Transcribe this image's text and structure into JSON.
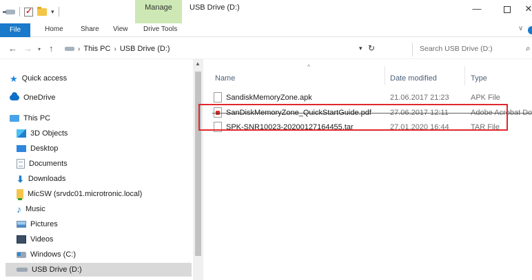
{
  "window": {
    "title": "USB Drive (D:)",
    "context_tab": "Manage",
    "controls": {
      "minimize": "—",
      "maximize": "",
      "close": "✕"
    }
  },
  "quick_access_toolbar": {
    "dropdown": "▾"
  },
  "ribbon": {
    "tabs": [
      "File",
      "Home",
      "Share",
      "View",
      "Drive Tools"
    ],
    "expand": "∨",
    "accent_color": "#1979ca",
    "manage_color": "#cde8b4"
  },
  "address_bar": {
    "back": "←",
    "forward": "→",
    "recent": "▾",
    "up": "↑",
    "separator": "›",
    "breadcrumbs": [
      "This PC",
      "USB Drive (D:)"
    ],
    "dropdown": "▾",
    "refresh": "↻"
  },
  "search": {
    "placeholder": "Search USB Drive (D:)",
    "icon": "search-icon"
  },
  "nav_pane": {
    "items": [
      {
        "label": "Quick access",
        "icon": "star-icon"
      },
      {
        "label": "OneDrive",
        "icon": "cloud-icon"
      },
      {
        "label": "This PC",
        "icon": "computer-icon"
      },
      {
        "label": "3D Objects",
        "icon": "cube-icon"
      },
      {
        "label": "Desktop",
        "icon": "desktop-icon"
      },
      {
        "label": "Documents",
        "icon": "document-icon"
      },
      {
        "label": "Downloads",
        "icon": "download-icon"
      },
      {
        "label": "MicSW (srvdc01.microtronic.local)",
        "icon": "network-folder-icon"
      },
      {
        "label": "Music",
        "icon": "music-icon"
      },
      {
        "label": "Pictures",
        "icon": "pictures-icon"
      },
      {
        "label": "Videos",
        "icon": "videos-icon"
      },
      {
        "label": "Windows (C:)",
        "icon": "windows-drive-icon"
      },
      {
        "label": "USB Drive (D:)",
        "icon": "usb-drive-icon"
      }
    ],
    "selected": "USB Drive (D:)",
    "scroll_up": "▲"
  },
  "file_list": {
    "columns": [
      "Name",
      "Date modified",
      "Type"
    ],
    "sort_indicator": "^",
    "rows": [
      {
        "name": "SandiskMemoryZone.apk",
        "date": "21.06.2017 21:23",
        "type": "APK File",
        "icon": "file-icon"
      },
      {
        "name": "SanDiskMemoryZone_QuickStartGuide.pdf",
        "date": "27.06.2017 12:11",
        "type": "Adobe Acrobat Doc",
        "icon": "pdf-icon"
      },
      {
        "name": "SPK-SNR10023-20200127164455.tar",
        "date": "27.01.2020 16:44",
        "type": "TAR File",
        "icon": "file-icon"
      }
    ],
    "highlight_color": "#e0262b"
  }
}
